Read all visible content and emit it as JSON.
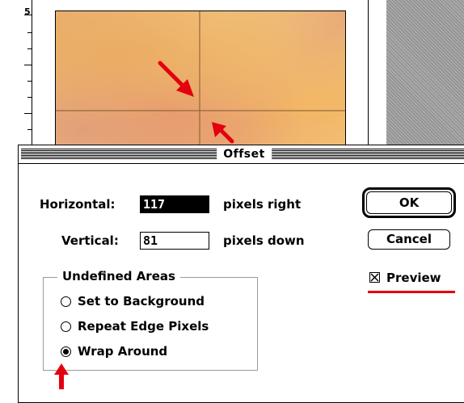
{
  "background_window": {
    "ruler_digit": "5",
    "accent_arrow_color": "#e3000f"
  },
  "dialog": {
    "title": "Offset",
    "horizontal_label": "Horizontal:",
    "horizontal_value": "117",
    "horizontal_unit": "pixels right",
    "vertical_label": "Vertical:",
    "vertical_value": "81",
    "vertical_unit": "pixels down",
    "ok_label": "OK",
    "cancel_label": "Cancel",
    "preview_label": "Preview",
    "preview_checked": true,
    "undefined_areas": {
      "title": "Undefined Areas",
      "options": [
        {
          "label": "Set to Background",
          "selected": false
        },
        {
          "label": "Repeat Edge Pixels",
          "selected": false
        },
        {
          "label": "Wrap Around",
          "selected": true
        }
      ]
    }
  }
}
